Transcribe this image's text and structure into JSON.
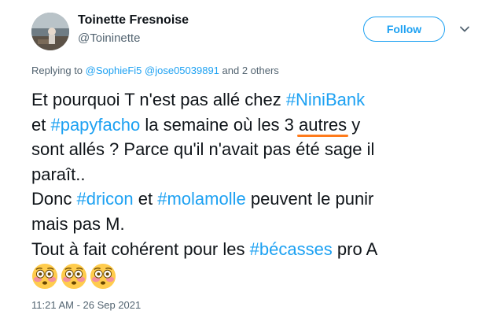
{
  "author": {
    "display_name": "Toinette Fresnoise",
    "handle": "@Toininette"
  },
  "actions": {
    "follow_label": "Follow",
    "more_icon": "chevron-down-icon"
  },
  "reply_context": {
    "prefix": "Replying to ",
    "mention_1": "@SophieFi5",
    "separator": " ",
    "mention_2": "@jose05039891",
    "suffix": " and 2 others"
  },
  "tweet": {
    "lines": {
      "l1_text": "Et pourquoi T n'est pas allé chez ",
      "l1_tag": "#NiniBank",
      "l2_text_a": "et ",
      "l2_tag": "#papyfacho",
      "l2_text_b": " la semaine où les 3 ",
      "l2_underlined": "autres",
      "l2_text_c": " y",
      "l3_text": "sont allés ? Parce qu'il n'avait pas été sage il",
      "l4_text": "paraît..",
      "l5_text_a": "Donc ",
      "l5_tag_1": "#dricon",
      "l5_text_b": " et ",
      "l5_tag_2": "#molamolle",
      "l5_text_c": " peuvent le punir",
      "l6_text": "mais pas M.",
      "l7_text_a": "Tout à fait cohérent pour les ",
      "l7_tag": "#bécasses",
      "l7_text_b": " pro A"
    },
    "emojis": [
      "flushed-face-emoji",
      "flushed-face-emoji",
      "flushed-face-emoji"
    ]
  },
  "timestamp": "11:21 AM - 26 Sep 2021",
  "colors": {
    "link": "#1da1f2",
    "text": "#0f1419",
    "secondary": "#536471",
    "annotation_underline": "#ff7a1a"
  }
}
